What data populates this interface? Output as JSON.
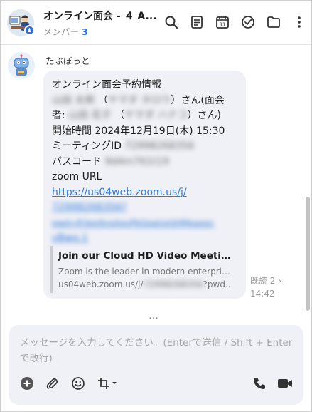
{
  "header": {
    "title": "オンライン面会 - ４ A...",
    "members_label": "メンバー",
    "members_count": "3"
  },
  "message": {
    "sender": "たぶぼっと",
    "lines": {
      "l1": "オンライン面会予約情報",
      "l2_blur1": "山田 太郎",
      "l2_open": "（",
      "l2_blur2": "ヤマダ タロウ",
      "l2_close": "）さん(面会",
      "l3_prefix": "者:",
      "l3_blur1": "山田 花子",
      "l3_open": "（",
      "l3_blur2": "ヤマダ ハナコ",
      "l3_close": "）さん)",
      "l4": "開始時間 2024年12月19日(木) 15:30",
      "l5_prefix": "ミーティングID",
      "l5_blur": "72998268356",
      "l6_prefix": "パスコード",
      "l6_blur": "9d4m761t19",
      "l7": "zoom URL",
      "link_1": "https://us04web.zoom.us/j/",
      "link_2_blur": "72998268356?",
      "link_3_blur": "pwd=R3ep9ysAgvPkGpaUxGHMeaxoc",
      "link_4_blur": "vBwo.1"
    },
    "card": {
      "title": "Join our Cloud HD Video Meeting",
      "description": "Zoom is the leader in modern enterprise video communications",
      "url_prefix": "us04web.zoom.us/j/",
      "url_blur": "72998268356",
      "url_suffix": "?pwd..."
    },
    "read_label": "既読 2",
    "read_chevron": "›",
    "time": "14:42"
  },
  "more_indicator": "…",
  "composer": {
    "placeholder": "メッセージを入力してください。(Enterで送信 / Shift + Enterで改行)"
  },
  "icons": {
    "search": "search-icon",
    "notes": "notes-icon",
    "calendar": "calendar-icon",
    "tasks": "tasks-icon",
    "folder": "folder-icon",
    "more": "more-vertical-icon",
    "add": "plus-icon",
    "attach": "paperclip-icon",
    "emoji": "emoji-icon",
    "crop": "crop-icon",
    "phone": "phone-icon",
    "video": "video-icon"
  },
  "colors": {
    "accent": "#2c7be5",
    "bubble": "#f0f1f7",
    "link": "#2f7bd8"
  }
}
